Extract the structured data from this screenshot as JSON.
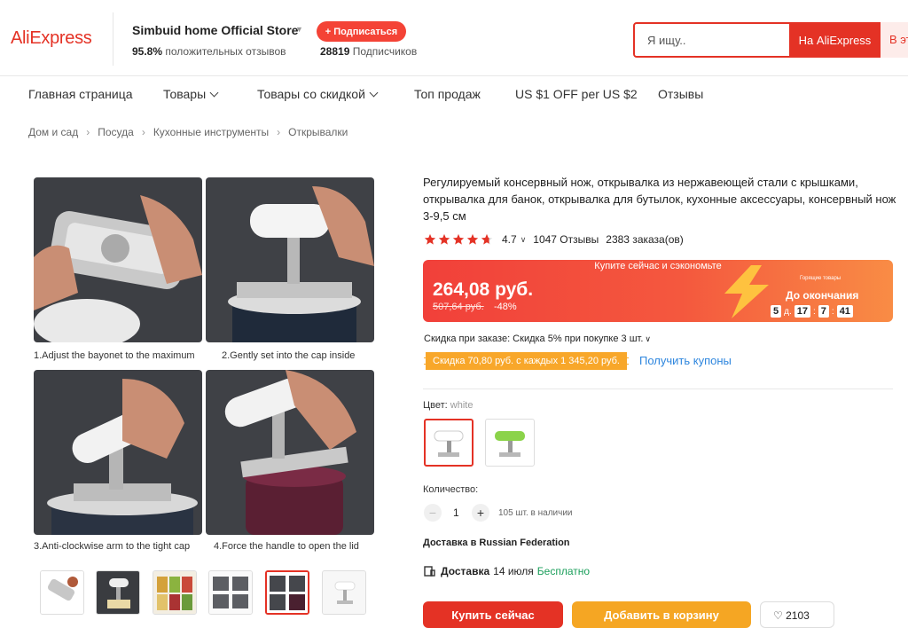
{
  "header": {
    "logo": "AliExpress",
    "store_name": "Simbuid home Official Store",
    "store_rating_pct": "95.8%",
    "store_rating_label": "положительных отзывов",
    "subscribe_label": "+ Подписаться",
    "followers_count": "28819",
    "followers_label": "Подписчиков",
    "search_placeholder": "Я ищу..",
    "search_aliexpress": "На AliExpress",
    "search_store": "В этом магазине"
  },
  "nav": [
    "Главная страница",
    "Товары",
    "Товары со скидкой",
    "Топ продаж",
    "US $1 OFF per US $2",
    "Отзывы"
  ],
  "breadcrumb": [
    "Дом и сад",
    "Посуда",
    "Кухонные инструменты",
    "Открывалки"
  ],
  "gallery": {
    "captions": [
      "1.Adjust the bayonet to the maximum",
      "2.Gently set into the cap inside",
      "3.Anti-clockwise arm to the tight cap",
      "4.Force the handle to open the lid"
    ]
  },
  "product": {
    "title": "Регулируемый консервный нож, открывалка из нержавеющей стали с крышками, открывалка для банок, открывалка для бутылок, кухонные аксессуары, консервный нож 3-9,5 см",
    "rating": "4.7",
    "rating_stars": 4.7,
    "reviews": "1047 Отзывы",
    "orders": "2383 заказа(ов)",
    "promo_banner": "Купите сейчас и сэкономьте",
    "price": "264,08 руб.",
    "old_price": "507,64 руб.",
    "discount": "-48%",
    "hot_label": "Горящие товары",
    "countdown_label": "До окончания",
    "countdown": {
      "days": "5",
      "days_label": "д.",
      "hours": "17",
      "minutes": "7",
      "seconds": "41"
    },
    "order_discount": "Скидка при заказе: Скидка 5% при покупке 3 шт.",
    "coupon": "Скидка 70,80 руб. с каждых 1 345,20 руб.",
    "get_coupons": "Получить купоны",
    "color_label": "Цвет:",
    "color_value": "white",
    "quantity_label": "Количество:",
    "quantity": "1",
    "stock": "105 шт. в наличии",
    "shipping_to": "Доставка в Russian Federation",
    "shipping_label": "Доставка",
    "shipping_date": "14 июля",
    "shipping_cost": "Бесплатно",
    "buy_now": "Купить сейчас",
    "add_to_cart": "Добавить в корзину",
    "wishlist_count": "2103"
  },
  "colors": {
    "accent": "#e43225",
    "coupon": "#f8a72a",
    "free": "#1a9e5a",
    "link": "#2e86de"
  }
}
